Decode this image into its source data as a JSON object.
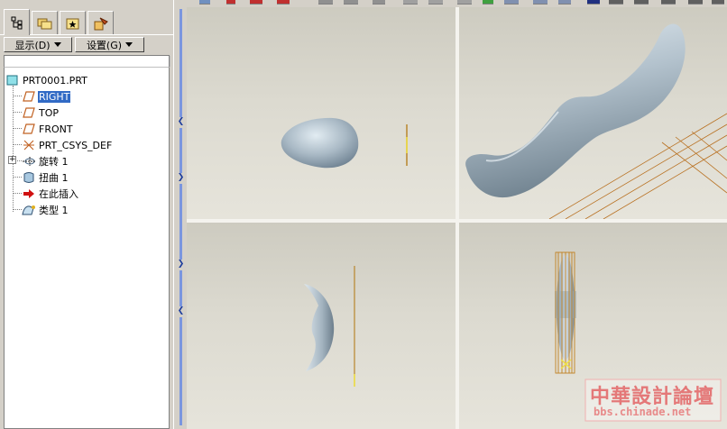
{
  "panel": {
    "tabs": [
      {
        "icon": "model-tree-icon",
        "active": true
      },
      {
        "icon": "folder-browser-icon",
        "active": false
      },
      {
        "icon": "favorites-icon",
        "active": false
      },
      {
        "icon": "connections-icon",
        "active": false
      }
    ],
    "show_menu_label": "显示(D)",
    "settings_menu_label": "设置(G)"
  },
  "tree": {
    "root": "PRT0001.PRT",
    "items": [
      {
        "label": "RIGHT",
        "icon": "datum-plane-icon",
        "selected": true
      },
      {
        "label": "TOP",
        "icon": "datum-plane-icon",
        "selected": false
      },
      {
        "label": "FRONT",
        "icon": "datum-plane-icon",
        "selected": false
      },
      {
        "label": "PRT_CSYS_DEF",
        "icon": "coordinate-system-icon",
        "selected": false
      },
      {
        "label": "旋转 1",
        "icon": "revolve-feature-icon",
        "selected": false,
        "expandable": true
      },
      {
        "label": "扭曲 1",
        "icon": "warp-feature-icon",
        "selected": false
      },
      {
        "label": "在此插入",
        "icon": "insert-here-arrow-icon",
        "selected": false
      },
      {
        "label": "类型 1",
        "icon": "style-feature-icon",
        "selected": false
      }
    ]
  },
  "watermark": {
    "title": "中華設計論壇",
    "url": "bbs.chinade.net"
  },
  "colors": {
    "selection": "#316ac5",
    "viewport_bg": "#d8d6cc",
    "model": "#a8b8c4",
    "datum": "#b8862c"
  }
}
